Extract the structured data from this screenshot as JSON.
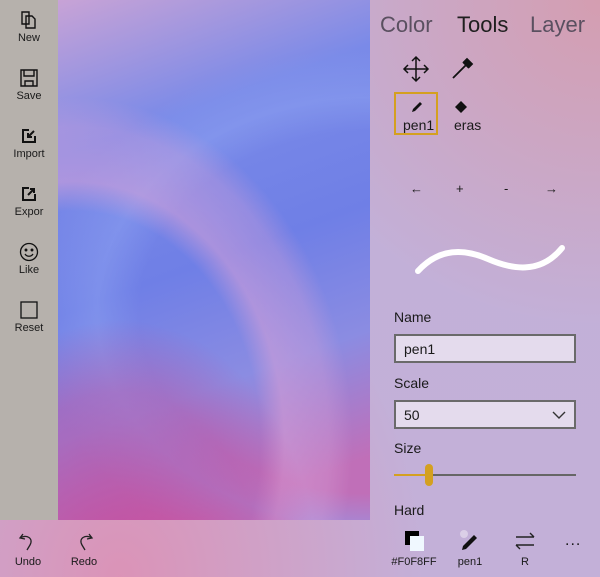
{
  "sidebar": {
    "items": [
      {
        "label": "New",
        "icon": "new-document-icon"
      },
      {
        "label": "Save",
        "icon": "save-icon"
      },
      {
        "label": "Import",
        "icon": "import-icon"
      },
      {
        "label": "Expor",
        "icon": "export-icon"
      },
      {
        "label": "Like",
        "icon": "smiley-icon"
      },
      {
        "label": "Reset",
        "icon": "reset-square-icon"
      }
    ]
  },
  "tabs": [
    {
      "label": "Color"
    },
    {
      "label": "Tools"
    },
    {
      "label": "Layer"
    }
  ],
  "active_tab": "Tools",
  "tools": {
    "brushes": [
      {
        "label": "pen1",
        "selected": true
      },
      {
        "label": "eras",
        "selected": false
      }
    ],
    "nav": [
      "←",
      "+",
      "-",
      "→"
    ]
  },
  "properties": {
    "name_label": "Name",
    "name_value": "pen1",
    "scale_label": "Scale",
    "scale_value": "50",
    "size_label": "Size",
    "size_fraction": 0.19,
    "hard_label": "Hard"
  },
  "bottombar": {
    "undo": "Undo",
    "redo": "Redo",
    "color": "#F0F8FF",
    "pen": "pen1",
    "swap": "R",
    "more": "..."
  },
  "colors": {
    "accent": "#d4a020",
    "swatch": "#F0F8FF"
  }
}
